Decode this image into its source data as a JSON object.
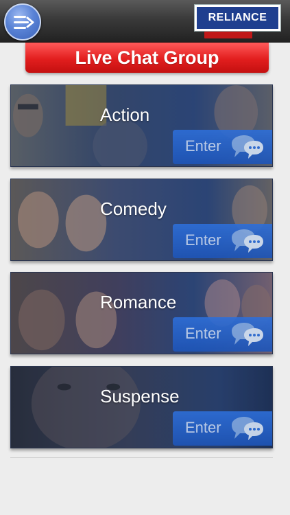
{
  "header": {
    "menu_icon": "menu-arrow-icon",
    "logo_text": "RELIANCE",
    "accent": "#1f3f8f"
  },
  "title": "Live Chat Group",
  "genres": [
    {
      "label": "Action",
      "button": "Enter",
      "icon": "chat-bubbles-icon"
    },
    {
      "label": "Comedy",
      "button": "Enter",
      "icon": "chat-bubbles-icon"
    },
    {
      "label": "Romance",
      "button": "Enter",
      "icon": "chat-bubbles-icon"
    },
    {
      "label": "Suspense",
      "button": "Enter",
      "icon": "chat-bubbles-icon"
    }
  ],
  "colors": {
    "title_red": "#e21e1e",
    "enter_blue": "#1e55b8",
    "card_overlay": "#1e3a6e"
  }
}
